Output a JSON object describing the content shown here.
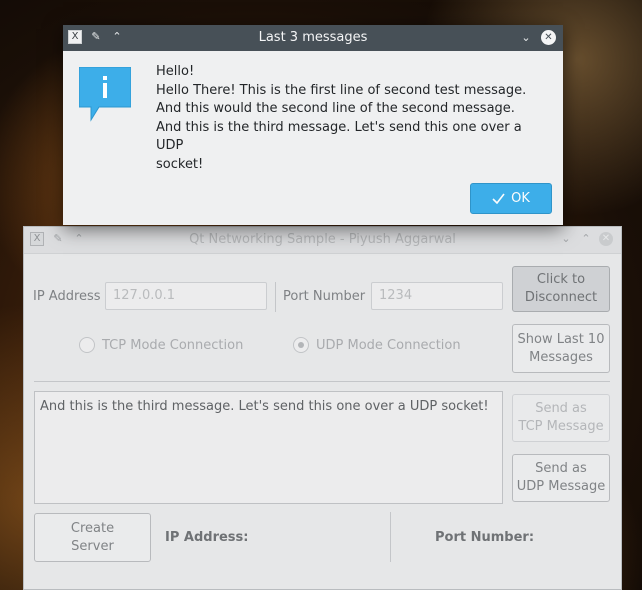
{
  "dialog": {
    "title": "Last 3 messages",
    "messages": [
      "Hello!",
      "Hello There! This is the first line of second test message.",
      "And this would the second line of the second message.",
      "And this is the third message. Let's send this one over a UDP",
      "socket!"
    ],
    "ok_label": "OK",
    "icon": "information-icon",
    "accent_color": "#3daee9"
  },
  "main": {
    "title": "Qt Networking Sample - Piyush Aggarwal",
    "ip_label": "IP Address",
    "ip_value": "127.0.0.1",
    "port_label": "Port Number",
    "port_value": "1234",
    "connect_button": "Click to\nDisconnect",
    "show_last_button": "Show Last 10\nMessages",
    "tcp_radio": "TCP Mode Connection",
    "udp_radio": "UDP Mode Connection",
    "message_text": "And this is the third message. Let's send this one over a UDP socket!",
    "send_tcp_button": "Send as\nTCP Message",
    "send_udp_button": "Send as\nUDP Message",
    "create_server_button": "Create\nServer",
    "server_ip_label": "IP Address:",
    "server_port_label": "Port Number:"
  }
}
